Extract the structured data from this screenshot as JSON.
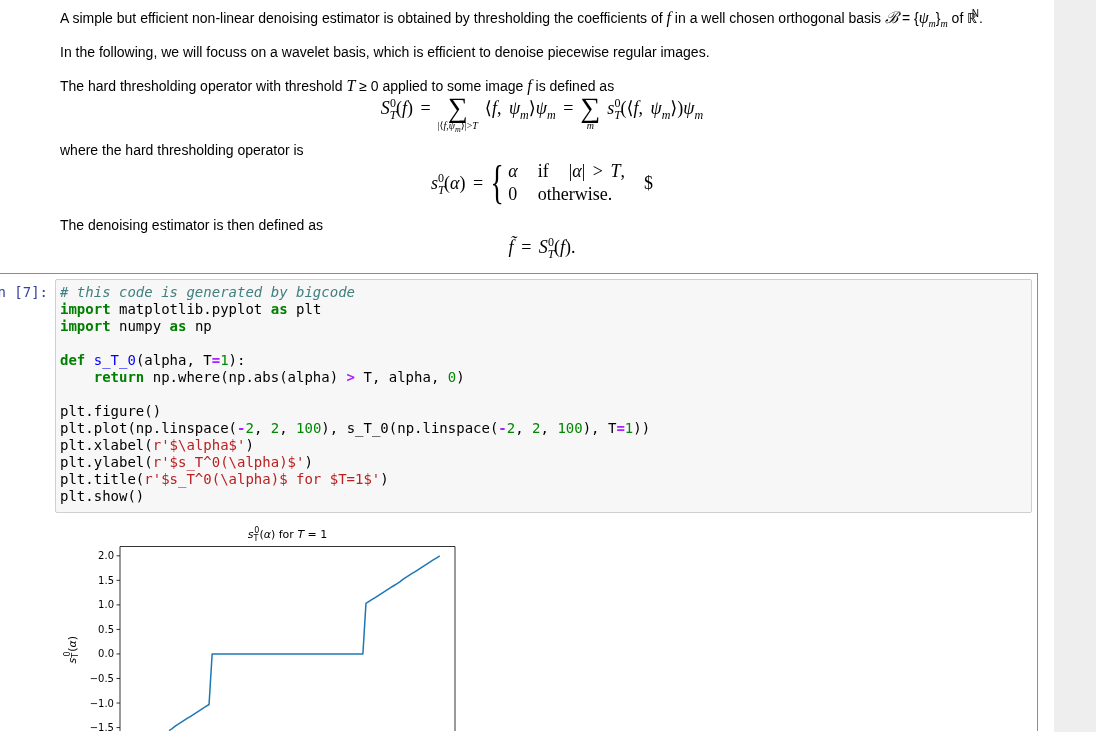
{
  "markdown": [
    {
      "kind": "paragraph",
      "text": "A simple but efficient non-linear denoising estimator is obtained by thresholding the coefficients of *f* in a well chosen orthogonal basis *ℬ* = {*ψ*$_{m}$}$_{m}$ of ℝ$^{N}$."
    },
    {
      "kind": "paragraph",
      "text": "In the following, we will focuss on a wavelet basis, which is efficient to denoise piecewise regular images."
    },
    {
      "kind": "paragraph",
      "text": "The hard thresholding operator with threshold *T* ≥ 0 applied to some image *f* is defined as"
    },
    {
      "kind": "formula",
      "pieces": [
        {
          "kind": "text",
          "text": "*S*$_{T}$$^{0}$(*f*) ="
        },
        {
          "kind": "sum",
          "symbol": "∑",
          "below": "|⟨*f*,*ψ*$_{m}$⟩|>*T*"
        },
        {
          "kind": "text",
          "text": "⟨*f*, *ψ*$_{m}$⟩*ψ*$_{m}$ ="
        },
        {
          "kind": "sum",
          "symbol": "∑",
          "below": "*m*"
        },
        {
          "kind": "text",
          "text": "*s*$_{T}$$^{0}$(⟨*f*, *ψ*$_{m}$⟩)*ψ*$_{m}$"
        }
      ]
    },
    {
      "kind": "paragraph",
      "text": "where the hard thresholding operator is"
    },
    {
      "kind": "formula",
      "pieces": [
        {
          "kind": "text",
          "text": "*s*$_{T}$$^{0}$(*α*) ="
        },
        {
          "kind": "cases",
          "brace": "{",
          "rows": [
            [
              "*α*",
              "if",
              "|*α*| > *T*,"
            ],
            [
              "0",
              "otherwise."
            ]
          ]
        },
        {
          "kind": "text",
          "text": "$"
        }
      ]
    },
    {
      "kind": "paragraph",
      "text": "The denoising estimator is then defined as"
    },
    {
      "kind": "formula",
      "pieces": [
        {
          "kind": "text",
          "text": "*f̃* = *S*$_{T}$$^{0}$(*f*)."
        }
      ]
    }
  ],
  "code_cell": {
    "prompt": "n [7]:",
    "lines": [
      {
        "kind": "code",
        "tokens": [
          {
            "kind": "comment",
            "text": "# this code is generated by bigcode"
          }
        ]
      },
      {
        "kind": "code",
        "tokens": [
          {
            "kind": "keyword",
            "text": "import"
          },
          {
            "kind": "plain",
            "text": " matplotlib.pyplot "
          },
          {
            "kind": "keyword",
            "text": "as"
          },
          {
            "kind": "plain",
            "text": " plt"
          }
        ]
      },
      {
        "kind": "code",
        "tokens": [
          {
            "kind": "keyword",
            "text": "import"
          },
          {
            "kind": "plain",
            "text": " numpy "
          },
          {
            "kind": "keyword",
            "text": "as"
          },
          {
            "kind": "plain",
            "text": " np"
          }
        ]
      },
      {
        "kind": "blank"
      },
      {
        "kind": "code",
        "tokens": [
          {
            "kind": "keyword",
            "text": "def"
          },
          {
            "kind": "def",
            "text": " s_T_0"
          },
          {
            "kind": "plain",
            "text": "(alpha, T"
          },
          {
            "kind": "operator",
            "text": "="
          },
          {
            "kind": "number",
            "text": "1"
          },
          {
            "kind": "plain",
            "text": "):"
          }
        ]
      },
      {
        "kind": "code",
        "tokens": [
          {
            "kind": "keyword",
            "text": "    return"
          },
          {
            "kind": "plain",
            "text": " np.where(np.abs(alpha) "
          },
          {
            "kind": "operator",
            "text": ">"
          },
          {
            "kind": "plain",
            "text": " T, alpha, "
          },
          {
            "kind": "number",
            "text": "0"
          },
          {
            "kind": "plain",
            "text": ")"
          }
        ]
      },
      {
        "kind": "blank"
      },
      {
        "kind": "code",
        "tokens": [
          {
            "kind": "plain",
            "text": "plt.figure()"
          }
        ]
      },
      {
        "kind": "code",
        "tokens": [
          {
            "kind": "plain",
            "text": "plt.plot(np.linspace("
          },
          {
            "kind": "operator",
            "text": "-"
          },
          {
            "kind": "number",
            "text": "2"
          },
          {
            "kind": "plain",
            "text": ", "
          },
          {
            "kind": "number",
            "text": "2"
          },
          {
            "kind": "plain",
            "text": ", "
          },
          {
            "kind": "number",
            "text": "100"
          },
          {
            "kind": "plain",
            "text": "), s_T_0(np.linspace("
          },
          {
            "kind": "operator",
            "text": "-"
          },
          {
            "kind": "number",
            "text": "2"
          },
          {
            "kind": "plain",
            "text": ", "
          },
          {
            "kind": "number",
            "text": "2"
          },
          {
            "kind": "plain",
            "text": ", "
          },
          {
            "kind": "number",
            "text": "100"
          },
          {
            "kind": "plain",
            "text": "), T"
          },
          {
            "kind": "operator",
            "text": "="
          },
          {
            "kind": "number",
            "text": "1"
          },
          {
            "kind": "plain",
            "text": "))"
          }
        ]
      },
      {
        "kind": "code",
        "tokens": [
          {
            "kind": "plain",
            "text": "plt.xlabel("
          },
          {
            "kind": "string",
            "text": "r'$\\alpha$'"
          },
          {
            "kind": "plain",
            "text": ")"
          }
        ]
      },
      {
        "kind": "code",
        "tokens": [
          {
            "kind": "plain",
            "text": "plt.ylabel("
          },
          {
            "kind": "string",
            "text": "r'$s_T^0(\\alpha)$'"
          },
          {
            "kind": "plain",
            "text": ")"
          }
        ]
      },
      {
        "kind": "code",
        "tokens": [
          {
            "kind": "plain",
            "text": "plt.title("
          },
          {
            "kind": "string",
            "text": "r'$s_T^0(\\alpha)$ for $T=1$'"
          },
          {
            "kind": "plain",
            "text": ")"
          }
        ]
      },
      {
        "kind": "code",
        "tokens": [
          {
            "kind": "plain",
            "text": "plt.show()"
          }
        ]
      }
    ],
    "output": {
      "chart_data": [
        {
          "type": "line",
          "title": "*s*$_{T}$$^{0}$(*α*) for *T* = 1",
          "ylabel": "*s*$_{T}$$^{0}$(*α*)",
          "categories": [
            null,
            null,
            null,
            null,
            null,
            null,
            null,
            null,
            null,
            null,
            null,
            null,
            null,
            null,
            null,
            null,
            null,
            null,
            null,
            null,
            null,
            null,
            null,
            null,
            null,
            null,
            null,
            null,
            null,
            null,
            null,
            null,
            null,
            null,
            null,
            null,
            null,
            null,
            null,
            null,
            null,
            null,
            null,
            null,
            null,
            null,
            null,
            null,
            null,
            null,
            null,
            null,
            null,
            null,
            null,
            null,
            null,
            null,
            null,
            null,
            null,
            null,
            null,
            null,
            null,
            null,
            null,
            null,
            null,
            null,
            null,
            null,
            null,
            null,
            null,
            null,
            null,
            null,
            null,
            null,
            null,
            null,
            null,
            null,
            null,
            null,
            null,
            null,
            null
          ],
          "values": [
            -1.56,
            -1.52,
            -1.47,
            -1.43,
            -1.39,
            -1.35,
            -1.31,
            -1.27,
            -1.23,
            -1.19,
            -1.15,
            -1.11,
            -1.07,
            -1.03,
            0,
            0,
            0,
            0,
            0,
            0,
            0,
            0,
            0,
            0,
            0,
            0,
            0,
            0,
            0,
            0,
            0,
            0,
            0,
            0,
            0,
            0,
            0,
            0,
            0,
            0,
            0,
            0,
            0,
            0,
            0,
            0,
            0,
            0,
            0,
            0,
            0,
            0,
            0,
            0,
            0,
            0,
            0,
            0,
            0,
            0,
            0,
            0,
            0,
            0,
            1.03,
            1.07,
            1.11,
            1.15,
            1.19,
            1.23,
            1.27,
            1.31,
            1.35,
            1.39,
            1.43,
            1.47,
            1.52,
            1.56,
            1.6,
            1.64,
            1.68,
            1.72,
            1.76,
            1.8,
            1.84,
            1.88,
            1.92,
            1.96,
            2
          ],
          "color": "#1f77b4",
          "ylim": [
            -1.57,
            2.2
          ],
          "yticks": [
            {
              "value": -1.5,
              "label": "−1.5"
            },
            {
              "value": -1,
              "label": "−1.0"
            },
            {
              "value": -0.5,
              "label": "−0.5"
            },
            {
              "value": 0,
              "label": "0.0"
            },
            {
              "value": 0.5,
              "label": "0.5"
            },
            {
              "value": 1,
              "label": "1.0"
            },
            {
              "value": 1.5,
              "label": "1.5"
            },
            {
              "value": 2,
              "label": "2.0"
            }
          ],
          "tick_labels": "y"
        }
      ]
    }
  }
}
